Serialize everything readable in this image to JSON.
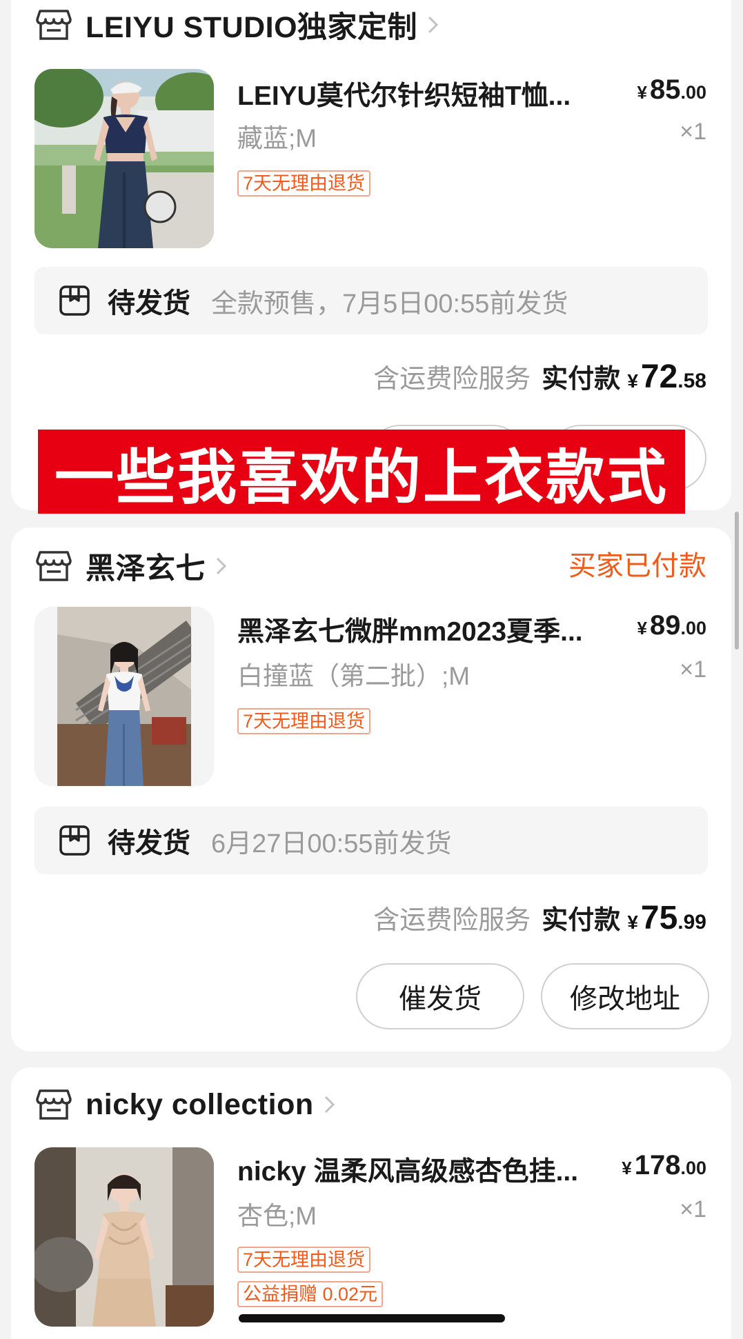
{
  "orders": [
    {
      "shop_name": "LEIYU STUDIO独家定制",
      "product_title": "LEIYU莫代尔针织短袖T恤...",
      "price_currency": "¥",
      "price_int": "85",
      "price_dec": ".00",
      "variant": "藏蓝;M",
      "quantity": "×1",
      "tags": [
        "7天无理由退货"
      ],
      "ship_status": "待发货",
      "ship_note": "全款预售，7月5日00:55前发货",
      "insurance_text": "含运费险服务",
      "paid_label": "实付款",
      "paid_currency": "¥",
      "paid_int": "72",
      "paid_dec": ".58"
    },
    {
      "shop_name": "黑泽玄七",
      "order_status": "买家已付款",
      "product_title": "黑泽玄七微胖mm2023夏季...",
      "price_currency": "¥",
      "price_int": "89",
      "price_dec": ".00",
      "variant": "白撞蓝（第二批）;M",
      "quantity": "×1",
      "tags": [
        "7天无理由退货"
      ],
      "ship_status": "待发货",
      "ship_note": "6月27日00:55前发货",
      "insurance_text": "含运费险服务",
      "paid_label": "实付款",
      "paid_currency": "¥",
      "paid_int": "75",
      "paid_dec": ".99",
      "buttons": [
        "催发货",
        "修改地址"
      ]
    },
    {
      "shop_name": "nicky collection",
      "product_title": "nicky 温柔风高级感杏色挂...",
      "price_currency": "¥",
      "price_int": "178",
      "price_dec": ".00",
      "variant": "杏色;M",
      "quantity": "×1",
      "tags": [
        "7天无理由退货",
        "公益捐赠 0.02元"
      ]
    }
  ],
  "overlay_banner": "一些我喜欢的上衣款式",
  "icons": {
    "shop": "store-icon",
    "chevron": "chevron-right-icon",
    "shipping": "package-box-icon"
  },
  "colors": {
    "accent": "#f05a1a",
    "banner_bg": "#e60012",
    "muted_text": "#9a9a9a"
  }
}
